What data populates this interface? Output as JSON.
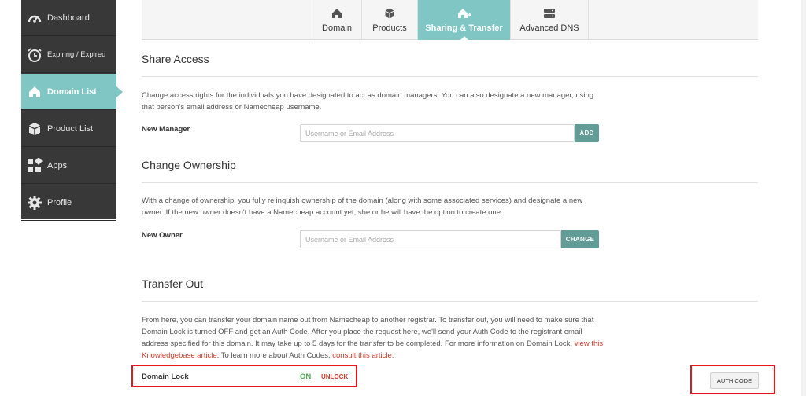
{
  "sidebar": {
    "items": [
      {
        "label": "Dashboard",
        "icon": "dashboard-gauge-icon"
      },
      {
        "label": "Expiring / Expired",
        "icon": "clock-icon"
      },
      {
        "label": "Domain List",
        "icon": "home-icon",
        "active": true
      },
      {
        "label": "Product List",
        "icon": "box-icon"
      },
      {
        "label": "Apps",
        "icon": "apps-grid-icon"
      },
      {
        "label": "Profile",
        "icon": "gear-icon"
      }
    ]
  },
  "tabs": [
    {
      "label": "Domain",
      "icon": "home-icon"
    },
    {
      "label": "Products",
      "icon": "box-icon"
    },
    {
      "label": "Sharing & Transfer",
      "icon": "home-share-icon",
      "active": true
    },
    {
      "label": "Advanced DNS",
      "icon": "server-icon"
    }
  ],
  "share_access": {
    "title": "Share Access",
    "description": "Change access rights for the individuals you have designated to act as domain managers. You can also designate a new manager, using that person's email address or Namecheap username.",
    "field_label": "New Manager",
    "placeholder": "Username or Email Address",
    "button": "ADD"
  },
  "change_ownership": {
    "title": "Change Ownership",
    "description": "With a change of ownership, you fully relinquish ownership of the domain (along with some associated services) and designate a new owner. If the new owner doesn't have a Namecheap account yet, she or he will have the option to create one.",
    "field_label": "New Owner",
    "placeholder": "Username or Email Address",
    "button": "CHANGE"
  },
  "transfer_out": {
    "title": "Transfer Out",
    "description_1": "From here, you can transfer your domain name out from Namecheap to another registrar. To transfer out, you will need to make sure that Domain Lock is turned OFF and get an Auth Code. After you place the request here, we'll send your Auth Code to the registrant email address specified for this domain. It may take up to 5 days for the transfer to be completed. For more information on Domain Lock,",
    "link_1": "view this Knowledgebase article.",
    "description_2": "To learn more about Auth Codes,",
    "link_2": "consult this article.",
    "lock_label": "Domain Lock",
    "lock_status": "ON",
    "unlock_button": "UNLOCK",
    "auth_button": "AUTH CODE"
  },
  "colors": {
    "accent": "#7fc6c4",
    "button": "#619c97",
    "sidebar": "#383838",
    "highlight": "#e5161e",
    "link": "#d23c2b",
    "on": "#4aa54f"
  }
}
